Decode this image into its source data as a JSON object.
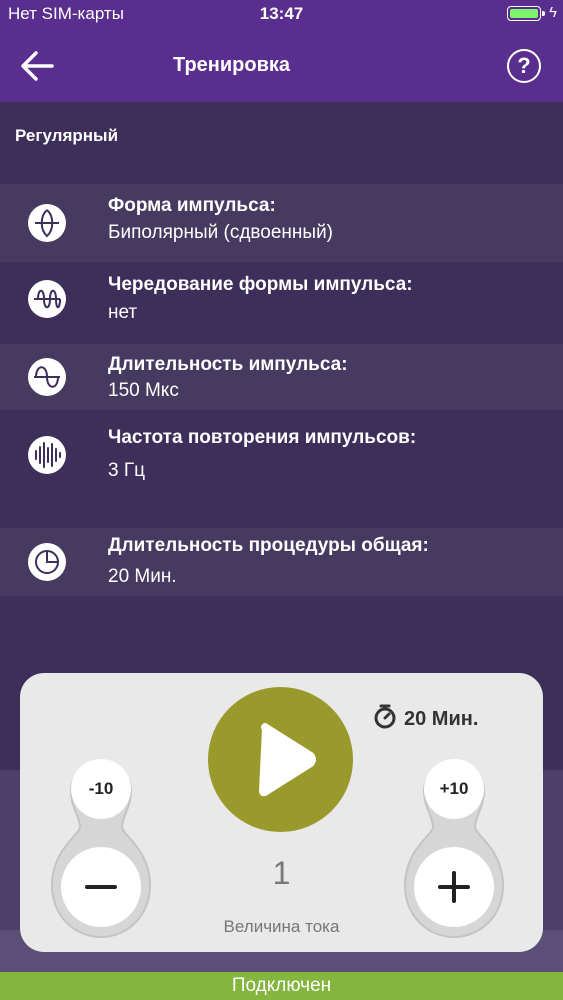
{
  "status_bar": {
    "carrier": "Нет SIM-карты",
    "time": "13:47"
  },
  "header": {
    "title": "Тренировка",
    "back_icon": "arrow-left-icon",
    "help_label": "?"
  },
  "section": {
    "title": "Регулярный"
  },
  "params": [
    {
      "label": "Форма импульса:",
      "value": "Биполярный (сдвоенный)",
      "icon": "bipolar-waveform-icon"
    },
    {
      "label": "Чередование формы импульса:",
      "value": "нет",
      "icon": "alternating-waveform-icon"
    },
    {
      "label": "Длительность импульса:",
      "value": "150 Мкс",
      "icon": "sine-wave-icon"
    },
    {
      "label": "Частота повторения импульсов:",
      "value": "3 Гц",
      "icon": "frequency-bars-icon"
    },
    {
      "label": "Длительность процедуры общая:",
      "value": "20 Мин.",
      "icon": "pie-clock-icon"
    }
  ],
  "control": {
    "timer": "20 Мин.",
    "current_value": "1",
    "current_label": "Величина тока",
    "minus_small": "-10",
    "plus_small": "+10",
    "minus_symbol": "−",
    "plus_symbol": "+"
  },
  "footer": {
    "status": "Подключен"
  },
  "colors": {
    "header": "#5a2e8e",
    "background": "#3d2f59",
    "play": "#9a9a2c",
    "footer": "#84b53e"
  }
}
